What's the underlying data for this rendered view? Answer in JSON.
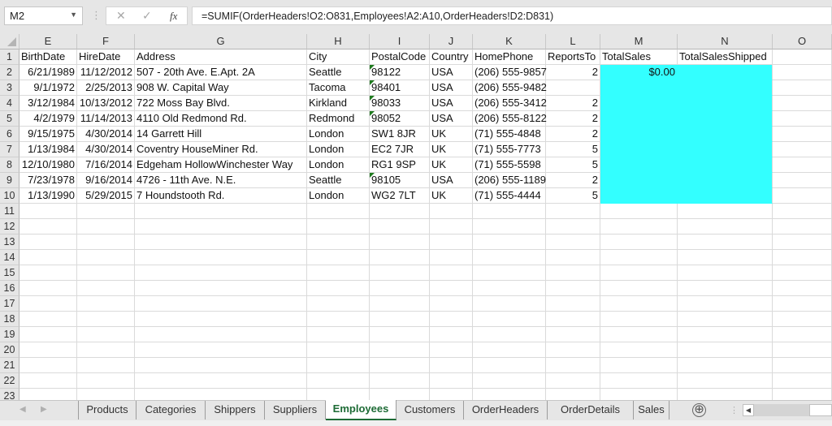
{
  "formula_bar": {
    "name_box": "M2",
    "cancel_icon": "✕",
    "enter_icon": "✓",
    "fx_label": "fx",
    "formula": "=SUMIF(OrderHeaders!O2:O831,Employees!A2:A10,OrderHeaders!D2:D831)"
  },
  "columns": [
    "E",
    "F",
    "G",
    "H",
    "I",
    "J",
    "K",
    "L",
    "M",
    "N",
    "O"
  ],
  "row_numbers": [
    "1",
    "2",
    "3",
    "4",
    "5",
    "6",
    "7",
    "8",
    "9",
    "10",
    "11",
    "12",
    "13",
    "14",
    "15",
    "16",
    "17",
    "18",
    "19",
    "20",
    "21",
    "22",
    "23"
  ],
  "headers": [
    "BirthDate",
    "HireDate",
    "Address",
    "City",
    "PostalCode",
    "Country",
    "HomePhone",
    "ReportsTo",
    "TotalSales",
    "TotalSalesShipped",
    ""
  ],
  "rows": [
    [
      "6/21/1989",
      "11/12/2012",
      "507 - 20th Ave. E.Apt. 2A",
      "Seattle",
      "98122",
      "USA",
      "(206) 555-9857",
      "2",
      "$0.00",
      "",
      ""
    ],
    [
      "9/1/1972",
      "2/25/2013",
      "908 W. Capital Way",
      "Tacoma",
      "98401",
      "USA",
      "(206) 555-9482",
      "",
      "",
      "",
      ""
    ],
    [
      "3/12/1984",
      "10/13/2012",
      "722 Moss Bay Blvd.",
      "Kirkland",
      "98033",
      "USA",
      "(206) 555-3412",
      "2",
      "",
      "",
      ""
    ],
    [
      "4/2/1979",
      "11/14/2013",
      "4110 Old Redmond Rd.",
      "Redmond",
      "98052",
      "USA",
      "(206) 555-8122",
      "2",
      "",
      "",
      ""
    ],
    [
      "9/15/1975",
      "4/30/2014",
      "14 Garrett Hill",
      "London",
      "SW1 8JR",
      "UK",
      "(71) 555-4848",
      "2",
      "",
      "",
      ""
    ],
    [
      "1/13/1984",
      "4/30/2014",
      "Coventry HouseMiner Rd.",
      "London",
      "EC2 7JR",
      "UK",
      "(71) 555-7773",
      "5",
      "",
      "",
      ""
    ],
    [
      "12/10/1980",
      "7/16/2014",
      "Edgeham HollowWinchester Way",
      "London",
      "RG1 9SP",
      "UK",
      "(71) 555-5598",
      "5",
      "",
      "",
      ""
    ],
    [
      "7/23/1978",
      "9/16/2014",
      "4726 - 11th Ave. N.E.",
      "Seattle",
      "98105",
      "USA",
      "(206) 555-1189",
      "2",
      "",
      "",
      ""
    ],
    [
      "1/13/1990",
      "5/29/2015",
      "7 Houndstooth Rd.",
      "London",
      "WG2 7LT",
      "UK",
      "(71) 555-4444",
      "5",
      "",
      "",
      ""
    ]
  ],
  "text_number_flag_rows": [
    0,
    1,
    2,
    3,
    7
  ],
  "highlight_color": "#33ffff",
  "sheet_tabs": [
    "Products",
    "Categories",
    "Shippers",
    "Suppliers",
    "Employees",
    "Customers",
    "OrderHeaders",
    "OrderDetails",
    "Sales"
  ],
  "active_tab": "Employees",
  "add_sheet_icon": "⊕",
  "accent_color": "#1d6b35"
}
